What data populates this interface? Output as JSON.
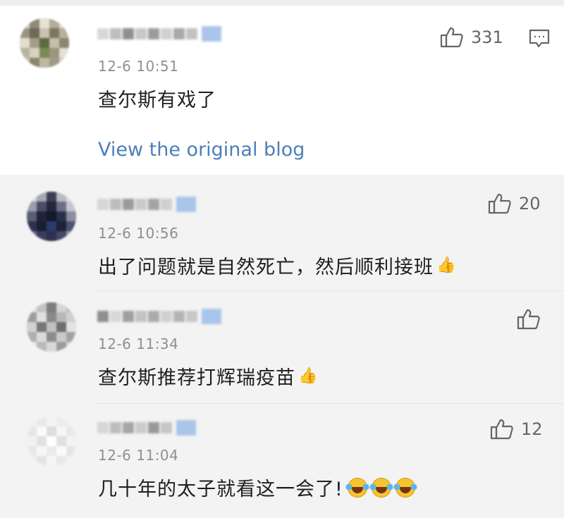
{
  "main": {
    "time": "12-6 10:51",
    "content": "查尔斯有戏了",
    "likes": "331",
    "view_link": "View the original blog"
  },
  "replies": [
    {
      "time": "12-6 10:56",
      "content": "出了问题就是自然死亡，然后顺利接班",
      "likes": "20",
      "emoji": "👍"
    },
    {
      "time": "12-6 11:34",
      "content": "查尔斯推荐打辉瑞疫苗",
      "likes": "",
      "emoji": "👍"
    },
    {
      "time": "12-6 11:04",
      "content": "几十年的太子就看这一会了!",
      "likes": "12",
      "emoji": "laugh"
    }
  ],
  "colors": {
    "link": "#4d7fb7",
    "badge": "#a9c6ea",
    "text": "#1f1f1f",
    "meta": "#8f8f8f"
  },
  "icons": {
    "like": "thumbs-up-icon",
    "comment": "comment-bubble-icon"
  }
}
